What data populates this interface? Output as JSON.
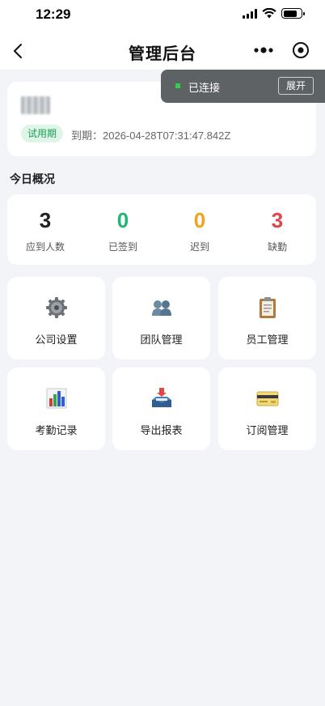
{
  "status_bar": {
    "time": "12:29"
  },
  "nav": {
    "title": "管理后台"
  },
  "toast": {
    "text": "已连接",
    "button": "展开"
  },
  "profile": {
    "badge": "试用期",
    "expiry": "到期：2026-04-28T07:31:47.842Z"
  },
  "overview": {
    "title": "今日概况",
    "stats": [
      {
        "value": "3",
        "label": "应到人数",
        "color": "#222222"
      },
      {
        "value": "0",
        "label": "已签到",
        "color": "#22b573"
      },
      {
        "value": "0",
        "label": "迟到",
        "color": "#f2a31b"
      },
      {
        "value": "3",
        "label": "缺勤",
        "color": "#e0474c"
      }
    ]
  },
  "menu": [
    {
      "label": "公司设置",
      "icon": "gear-icon"
    },
    {
      "label": "团队管理",
      "icon": "team-icon"
    },
    {
      "label": "员工管理",
      "icon": "clipboard-icon"
    },
    {
      "label": "考勤记录",
      "icon": "bar-chart-icon"
    },
    {
      "label": "导出报表",
      "icon": "inbox-tray-icon"
    },
    {
      "label": "订阅管理",
      "icon": "credit-card-icon"
    }
  ]
}
